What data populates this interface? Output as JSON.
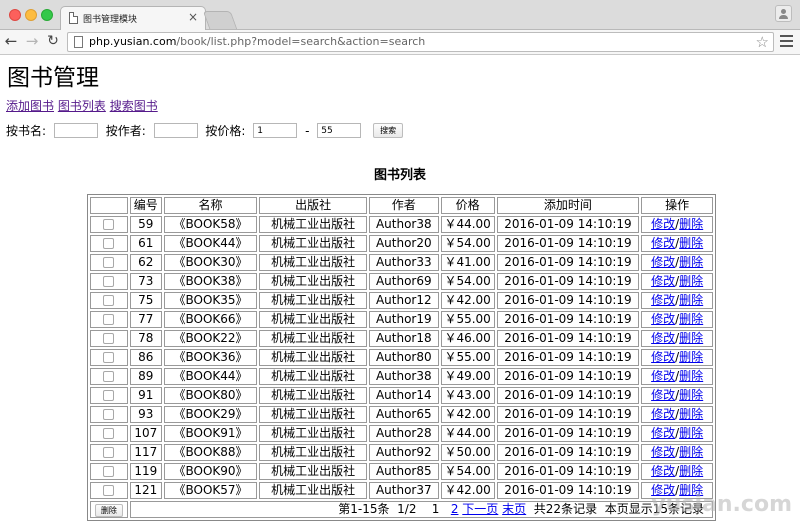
{
  "browser": {
    "tab_title": "图书管理模块",
    "url_host": "php.yusian.com",
    "url_path": "/book/list.php?model=search&action=search"
  },
  "page": {
    "title": "图书管理",
    "nav_links": [
      "添加图书",
      "图书列表",
      "搜索图书"
    ]
  },
  "search": {
    "title_label": "按书名:",
    "author_label": "按作者:",
    "price_label": "按价格:",
    "price_min": "1",
    "price_sep": "-",
    "price_max": "55",
    "button": "搜索"
  },
  "table": {
    "caption": "图书列表",
    "headers": [
      "",
      "编号",
      "名称",
      "出版社",
      "作者",
      "价格",
      "添加时间",
      "操作"
    ],
    "edit_label": "修改",
    "sep": "/",
    "delete_label": "删除",
    "rows": [
      {
        "id": "59",
        "name": "《BOOK58》",
        "publisher": "机械工业出版社",
        "author": "Author38",
        "price": "￥44.00",
        "time": "2016-01-09 14:10:19"
      },
      {
        "id": "61",
        "name": "《BOOK44》",
        "publisher": "机械工业出版社",
        "author": "Author20",
        "price": "￥54.00",
        "time": "2016-01-09 14:10:19"
      },
      {
        "id": "62",
        "name": "《BOOK30》",
        "publisher": "机械工业出版社",
        "author": "Author33",
        "price": "￥41.00",
        "time": "2016-01-09 14:10:19"
      },
      {
        "id": "73",
        "name": "《BOOK38》",
        "publisher": "机械工业出版社",
        "author": "Author69",
        "price": "￥54.00",
        "time": "2016-01-09 14:10:19"
      },
      {
        "id": "75",
        "name": "《BOOK35》",
        "publisher": "机械工业出版社",
        "author": "Author12",
        "price": "￥42.00",
        "time": "2016-01-09 14:10:19"
      },
      {
        "id": "77",
        "name": "《BOOK66》",
        "publisher": "机械工业出版社",
        "author": "Author19",
        "price": "￥55.00",
        "time": "2016-01-09 14:10:19"
      },
      {
        "id": "78",
        "name": "《BOOK22》",
        "publisher": "机械工业出版社",
        "author": "Author18",
        "price": "￥46.00",
        "time": "2016-01-09 14:10:19"
      },
      {
        "id": "86",
        "name": "《BOOK36》",
        "publisher": "机械工业出版社",
        "author": "Author80",
        "price": "￥55.00",
        "time": "2016-01-09 14:10:19"
      },
      {
        "id": "89",
        "name": "《BOOK44》",
        "publisher": "机械工业出版社",
        "author": "Author38",
        "price": "￥49.00",
        "time": "2016-01-09 14:10:19"
      },
      {
        "id": "91",
        "name": "《BOOK80》",
        "publisher": "机械工业出版社",
        "author": "Author14",
        "price": "￥43.00",
        "time": "2016-01-09 14:10:19"
      },
      {
        "id": "93",
        "name": "《BOOK29》",
        "publisher": "机械工业出版社",
        "author": "Author65",
        "price": "￥42.00",
        "time": "2016-01-09 14:10:19"
      },
      {
        "id": "107",
        "name": "《BOOK91》",
        "publisher": "机械工业出版社",
        "author": "Author28",
        "price": "￥44.00",
        "time": "2016-01-09 14:10:19"
      },
      {
        "id": "117",
        "name": "《BOOK88》",
        "publisher": "机械工业出版社",
        "author": "Author92",
        "price": "￥50.00",
        "time": "2016-01-09 14:10:19"
      },
      {
        "id": "119",
        "name": "《BOOK90》",
        "publisher": "机械工业出版社",
        "author": "Author85",
        "price": "￥54.00",
        "time": "2016-01-09 14:10:19"
      },
      {
        "id": "121",
        "name": "《BOOK57》",
        "publisher": "机械工业出版社",
        "author": "Author37",
        "price": "￥42.00",
        "time": "2016-01-09 14:10:19"
      }
    ]
  },
  "footer": {
    "delete_button": "删除",
    "range_text": "第1-15条",
    "page_of": "1/2",
    "current_page": "1",
    "page2_link": "2",
    "next_link": "下一页",
    "last_link": "末页",
    "total_text": "共22条记录",
    "page_size_text": "本页显示15条记录"
  },
  "watermark": "yusian.com",
  "icons": {
    "tab": "document-icon",
    "back": "arrow-left-icon",
    "forward": "arrow-right-icon",
    "reload": "reload-icon",
    "star": "star-icon",
    "menu": "hamburger-menu-icon",
    "profile": "user-icon"
  }
}
